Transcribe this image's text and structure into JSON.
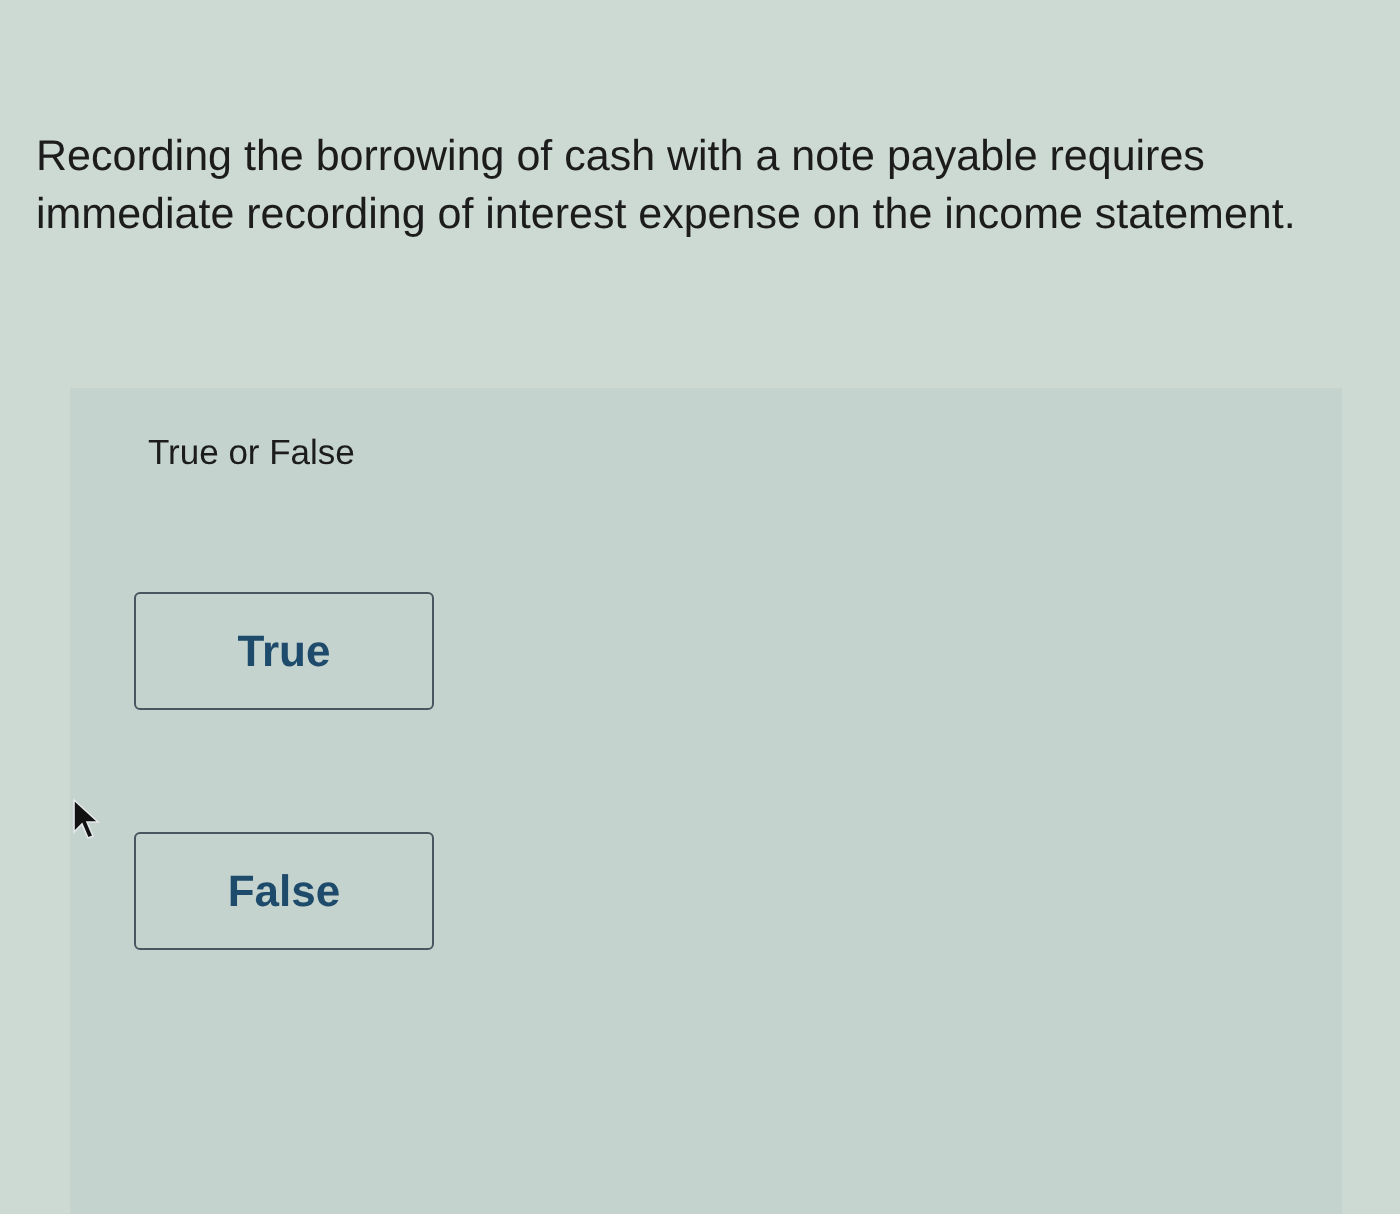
{
  "question": {
    "text": "Recording the borrowing of cash with a note payable requires immediate recording of interest expense on the income statement."
  },
  "answer_panel": {
    "prompt": "True or False",
    "options": [
      {
        "label": "True",
        "selected": false
      },
      {
        "label": "False",
        "selected": false
      }
    ]
  }
}
